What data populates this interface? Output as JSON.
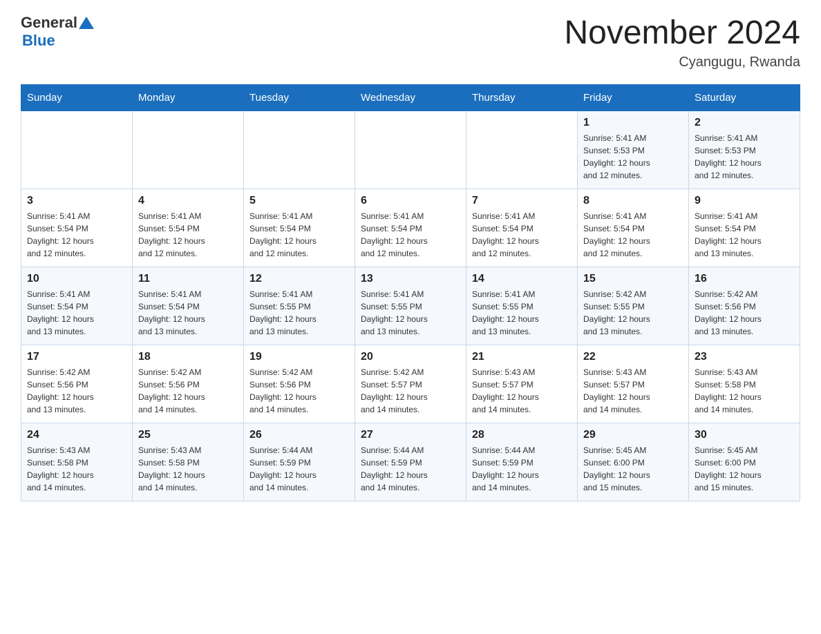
{
  "header": {
    "logo_general": "General",
    "logo_blue": "Blue",
    "month_title": "November 2024",
    "location": "Cyangugu, Rwanda"
  },
  "days_of_week": [
    "Sunday",
    "Monday",
    "Tuesday",
    "Wednesday",
    "Thursday",
    "Friday",
    "Saturday"
  ],
  "weeks": [
    [
      {
        "day": "",
        "info": ""
      },
      {
        "day": "",
        "info": ""
      },
      {
        "day": "",
        "info": ""
      },
      {
        "day": "",
        "info": ""
      },
      {
        "day": "",
        "info": ""
      },
      {
        "day": "1",
        "info": "Sunrise: 5:41 AM\nSunset: 5:53 PM\nDaylight: 12 hours\nand 12 minutes."
      },
      {
        "day": "2",
        "info": "Sunrise: 5:41 AM\nSunset: 5:53 PM\nDaylight: 12 hours\nand 12 minutes."
      }
    ],
    [
      {
        "day": "3",
        "info": "Sunrise: 5:41 AM\nSunset: 5:54 PM\nDaylight: 12 hours\nand 12 minutes."
      },
      {
        "day": "4",
        "info": "Sunrise: 5:41 AM\nSunset: 5:54 PM\nDaylight: 12 hours\nand 12 minutes."
      },
      {
        "day": "5",
        "info": "Sunrise: 5:41 AM\nSunset: 5:54 PM\nDaylight: 12 hours\nand 12 minutes."
      },
      {
        "day": "6",
        "info": "Sunrise: 5:41 AM\nSunset: 5:54 PM\nDaylight: 12 hours\nand 12 minutes."
      },
      {
        "day": "7",
        "info": "Sunrise: 5:41 AM\nSunset: 5:54 PM\nDaylight: 12 hours\nand 12 minutes."
      },
      {
        "day": "8",
        "info": "Sunrise: 5:41 AM\nSunset: 5:54 PM\nDaylight: 12 hours\nand 12 minutes."
      },
      {
        "day": "9",
        "info": "Sunrise: 5:41 AM\nSunset: 5:54 PM\nDaylight: 12 hours\nand 13 minutes."
      }
    ],
    [
      {
        "day": "10",
        "info": "Sunrise: 5:41 AM\nSunset: 5:54 PM\nDaylight: 12 hours\nand 13 minutes."
      },
      {
        "day": "11",
        "info": "Sunrise: 5:41 AM\nSunset: 5:54 PM\nDaylight: 12 hours\nand 13 minutes."
      },
      {
        "day": "12",
        "info": "Sunrise: 5:41 AM\nSunset: 5:55 PM\nDaylight: 12 hours\nand 13 minutes."
      },
      {
        "day": "13",
        "info": "Sunrise: 5:41 AM\nSunset: 5:55 PM\nDaylight: 12 hours\nand 13 minutes."
      },
      {
        "day": "14",
        "info": "Sunrise: 5:41 AM\nSunset: 5:55 PM\nDaylight: 12 hours\nand 13 minutes."
      },
      {
        "day": "15",
        "info": "Sunrise: 5:42 AM\nSunset: 5:55 PM\nDaylight: 12 hours\nand 13 minutes."
      },
      {
        "day": "16",
        "info": "Sunrise: 5:42 AM\nSunset: 5:56 PM\nDaylight: 12 hours\nand 13 minutes."
      }
    ],
    [
      {
        "day": "17",
        "info": "Sunrise: 5:42 AM\nSunset: 5:56 PM\nDaylight: 12 hours\nand 13 minutes."
      },
      {
        "day": "18",
        "info": "Sunrise: 5:42 AM\nSunset: 5:56 PM\nDaylight: 12 hours\nand 14 minutes."
      },
      {
        "day": "19",
        "info": "Sunrise: 5:42 AM\nSunset: 5:56 PM\nDaylight: 12 hours\nand 14 minutes."
      },
      {
        "day": "20",
        "info": "Sunrise: 5:42 AM\nSunset: 5:57 PM\nDaylight: 12 hours\nand 14 minutes."
      },
      {
        "day": "21",
        "info": "Sunrise: 5:43 AM\nSunset: 5:57 PM\nDaylight: 12 hours\nand 14 minutes."
      },
      {
        "day": "22",
        "info": "Sunrise: 5:43 AM\nSunset: 5:57 PM\nDaylight: 12 hours\nand 14 minutes."
      },
      {
        "day": "23",
        "info": "Sunrise: 5:43 AM\nSunset: 5:58 PM\nDaylight: 12 hours\nand 14 minutes."
      }
    ],
    [
      {
        "day": "24",
        "info": "Sunrise: 5:43 AM\nSunset: 5:58 PM\nDaylight: 12 hours\nand 14 minutes."
      },
      {
        "day": "25",
        "info": "Sunrise: 5:43 AM\nSunset: 5:58 PM\nDaylight: 12 hours\nand 14 minutes."
      },
      {
        "day": "26",
        "info": "Sunrise: 5:44 AM\nSunset: 5:59 PM\nDaylight: 12 hours\nand 14 minutes."
      },
      {
        "day": "27",
        "info": "Sunrise: 5:44 AM\nSunset: 5:59 PM\nDaylight: 12 hours\nand 14 minutes."
      },
      {
        "day": "28",
        "info": "Sunrise: 5:44 AM\nSunset: 5:59 PM\nDaylight: 12 hours\nand 14 minutes."
      },
      {
        "day": "29",
        "info": "Sunrise: 5:45 AM\nSunset: 6:00 PM\nDaylight: 12 hours\nand 15 minutes."
      },
      {
        "day": "30",
        "info": "Sunrise: 5:45 AM\nSunset: 6:00 PM\nDaylight: 12 hours\nand 15 minutes."
      }
    ]
  ]
}
